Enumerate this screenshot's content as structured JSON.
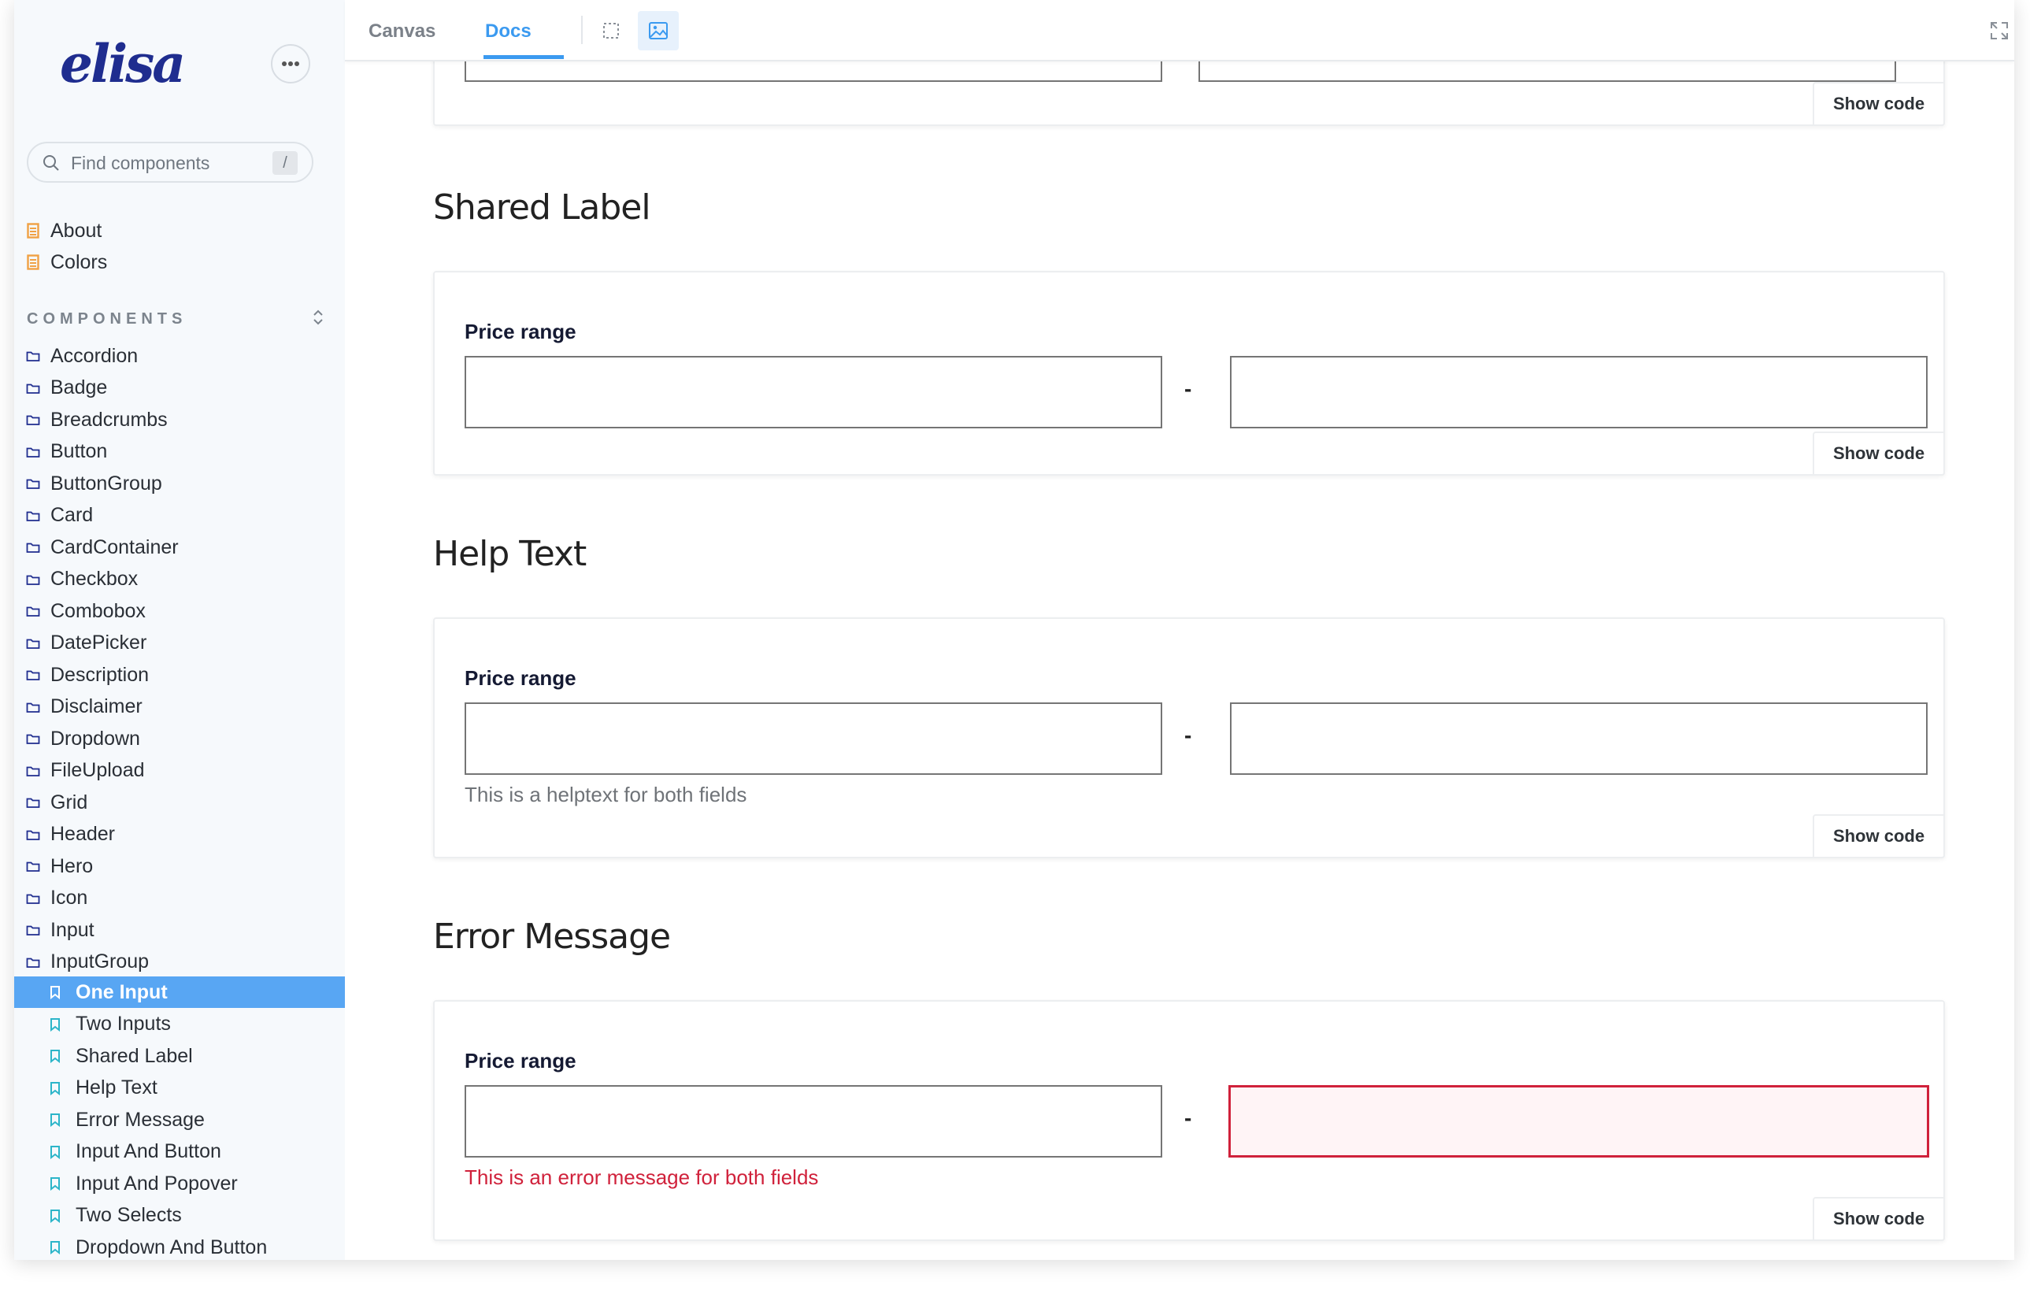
{
  "brand": {
    "logo_text": "elisa",
    "accent": "#1f2d8f"
  },
  "sidebar": {
    "search_placeholder": "Find components",
    "search_shortcut": "/",
    "docs": [
      {
        "label": "About",
        "icon": "document-icon"
      },
      {
        "label": "Colors",
        "icon": "document-icon"
      }
    ],
    "section_label": "COMPONENTS",
    "components": [
      "Accordion",
      "Badge",
      "Breadcrumbs",
      "Button",
      "ButtonGroup",
      "Card",
      "CardContainer",
      "Checkbox",
      "Combobox",
      "DatePicker",
      "Description",
      "Disclaimer",
      "Dropdown",
      "FileUpload",
      "Grid",
      "Header",
      "Hero",
      "Icon",
      "Input",
      "InputGroup"
    ],
    "stories": [
      "One Input",
      "Two Inputs",
      "Shared Label",
      "Help Text",
      "Error Message",
      "Input And Button",
      "Input And Popover",
      "Two Selects",
      "Dropdown And Button"
    ],
    "active_story": "One Input"
  },
  "toolbar": {
    "tabs": [
      {
        "label": "Canvas",
        "active": false
      },
      {
        "label": "Docs",
        "active": true
      }
    ],
    "tools": [
      "outline-icon",
      "image-icon"
    ],
    "fullscreen_icon": "expand-icon"
  },
  "docs": {
    "show_code_label": "Show code",
    "sections": {
      "shared_label": {
        "heading": "Shared Label",
        "label": "Price range",
        "separator": "-"
      },
      "help_text": {
        "heading": "Help Text",
        "label": "Price range",
        "separator": "-",
        "help": "This is a helptext for both fields"
      },
      "error_message": {
        "heading": "Error Message",
        "label": "Price range",
        "separator": "-",
        "error": "This is an error message for both fields"
      }
    }
  },
  "colors": {
    "active_story_bg": "#58a6f3",
    "tab_active": "#3b9af0",
    "error": "#d0213b"
  }
}
